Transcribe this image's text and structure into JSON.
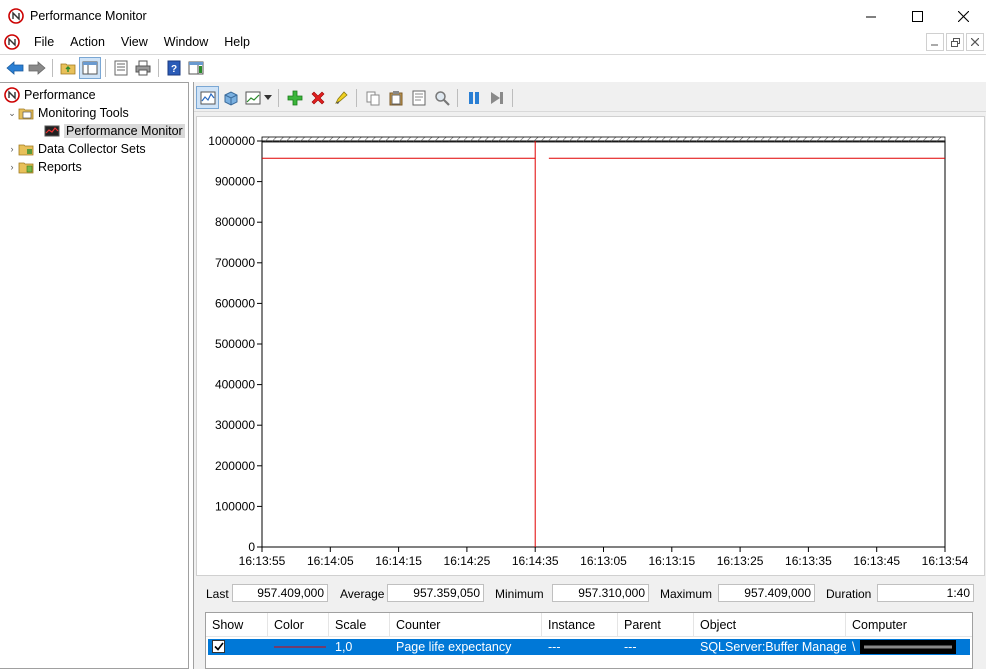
{
  "window": {
    "title": "Performance Monitor",
    "minimize_glyph": "—",
    "maximize_glyph": "☐",
    "close_glyph": "✕"
  },
  "menu": [
    "File",
    "Action",
    "View",
    "Window",
    "Help"
  ],
  "tree": {
    "root": "Performance",
    "monitoring_tools": "Monitoring Tools",
    "performance_monitor": "Performance Monitor",
    "data_collector_sets": "Data Collector Sets",
    "reports": "Reports"
  },
  "chart_data": {
    "type": "line",
    "y_ticks": [
      "1000000",
      "900000",
      "800000",
      "700000",
      "600000",
      "500000",
      "400000",
      "300000",
      "200000",
      "100000",
      "0"
    ],
    "ylim": [
      0,
      1000000
    ],
    "x_ticks": [
      "16:13:55",
      "16:14:05",
      "16:14:15",
      "16:14:25",
      "16:14:35",
      "16:13:05",
      "16:13:15",
      "16:13:25",
      "16:13:35",
      "16:13:45",
      "16:13:54"
    ],
    "series": [
      {
        "color": "#e00000",
        "segments": [
          {
            "from_tick": 0,
            "to_tick": 4,
            "value": 957359
          },
          {
            "from_tick": 4.2,
            "to_tick": 10,
            "value": 957359
          }
        ]
      }
    ],
    "current_time_tick": 4,
    "grid": false
  },
  "stats": {
    "last_label": "Last",
    "last_value": "957.409,000",
    "average_label": "Average",
    "average_value": "957.359,050",
    "minimum_label": "Minimum",
    "minimum_value": "957.310,000",
    "maximum_label": "Maximum",
    "maximum_value": "957.409,000",
    "duration_label": "Duration",
    "duration_value": "1:40"
  },
  "counter_list": {
    "columns": [
      "Show",
      "Color",
      "Scale",
      "Counter",
      "Instance",
      "Parent",
      "Object",
      "Computer"
    ],
    "rows": [
      {
        "show": true,
        "color": "#e00000",
        "scale": "1,0",
        "counter": "Page life expectancy",
        "instance": "---",
        "parent": "---",
        "object": "SQLServer:Buffer Manager",
        "computer": "\\"
      }
    ]
  }
}
